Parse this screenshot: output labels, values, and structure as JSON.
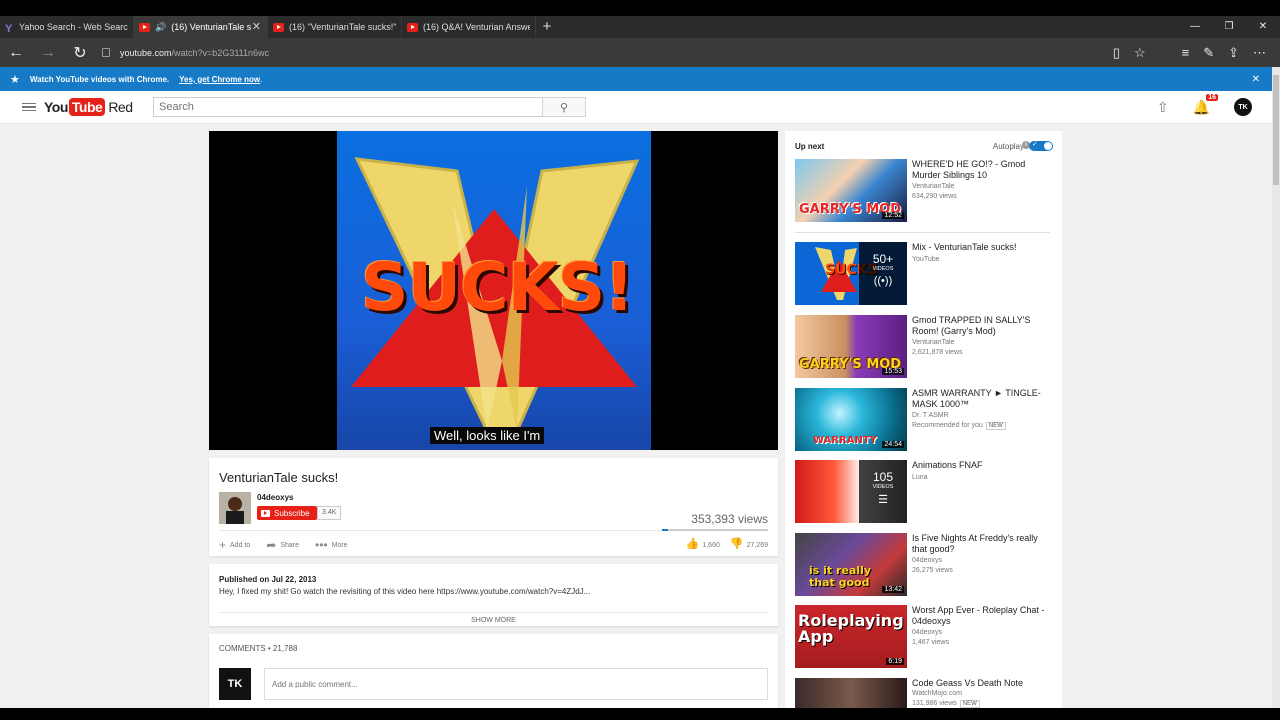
{
  "browser": {
    "tabs": [
      {
        "title": "Yahoo Search - Web Search",
        "icon": "yahoo-icon"
      },
      {
        "title": "(16) VenturianTale s",
        "icon": "youtube-icon",
        "audio": true
      },
      {
        "title": "(16) \"VenturianTale sucks!\" (",
        "icon": "youtube-icon"
      },
      {
        "title": "(16) Q&A! Venturian Answe",
        "icon": "youtube-icon"
      }
    ],
    "url_host": "youtube.com",
    "url_path": "/watch?v=b2G3111n6wc"
  },
  "banner": {
    "text": "Watch YouTube videos with Chrome.",
    "link": "Yes, get Chrome now",
    "suffix": "."
  },
  "header": {
    "logo_you": "You",
    "logo_tube": "Tube",
    "logo_red": "Red",
    "search_placeholder": "Search",
    "notif_count": "16",
    "avatar_label": "TK"
  },
  "video": {
    "caption": "Well, looks like I'm",
    "thumb_text": "SUCKS!",
    "title": "VenturianTale sucks!",
    "channel": "04deoxys",
    "subscribe_label": "Subscribe",
    "subscriber_count": "3.4K",
    "views": "353,393 views",
    "add_to": "Add to",
    "share": "Share",
    "more": "More",
    "likes": "1,660",
    "dislikes": "27,269",
    "like_ratio": 0.057,
    "published": "Published on Jul 22, 2013",
    "description": "Hey, I fixed my shit! Go watch the revisiting of this video here https://www.youtube.com/watch?v=4ZJdJ...",
    "show_more": "SHOW MORE",
    "comments_label": "COMMENTS",
    "comments_count": "21,788",
    "comment_placeholder": "Add a public comment...",
    "user_avatar": "TK"
  },
  "sidebar": {
    "up_next": "Up next",
    "autoplay": "Autoplay",
    "items": [
      {
        "title": "WHERE'D HE GO!? - Gmod Murder Siblings 10",
        "channel": "VenturianTale",
        "views": "634,290 views",
        "duration": "12:52",
        "thumb_text": "GARRY'S MOD"
      },
      {
        "title": "Mix - VenturianTale sucks!",
        "channel": "YouTube",
        "views": "",
        "playlist_count": "50+",
        "playlist_label": "VIDEOS",
        "thumb_text": "SUCKS"
      },
      {
        "title": "Gmod TRAPPED IN SALLY'S Room! (Garry's Mod)",
        "channel": "VenturianTale",
        "views": "2,621,878 views",
        "duration": "15:53",
        "thumb_text": "GARRY'S MOD"
      },
      {
        "title": "ASMR WARRANTY ► TINGLE-MASK 1000™",
        "channel": "Dr. T ASMR",
        "views": "Recommended for you",
        "badge": "NEW",
        "duration": "24:54",
        "thumb_text": "WARRANTY"
      },
      {
        "title": "Animations FNAF",
        "channel": "Luna",
        "views": "",
        "playlist_count": "105",
        "playlist_label": "VIDEOS"
      },
      {
        "title": "Is Five Nights At Freddy's really that good?",
        "channel": "04deoxys",
        "views": "26,275 views",
        "duration": "13:42",
        "thumb_text": "is it really that good"
      },
      {
        "title": "Worst App Ever - Roleplay Chat - 04deoxys",
        "channel": "04deoxys",
        "views": "1,467 views",
        "duration": "6:19",
        "thumb_text": "Roleplaying App"
      },
      {
        "title": "Code Geass Vs Death Note",
        "channel": "WatchMojo.com",
        "views": "131,986 views",
        "badge": "NEW"
      }
    ]
  }
}
